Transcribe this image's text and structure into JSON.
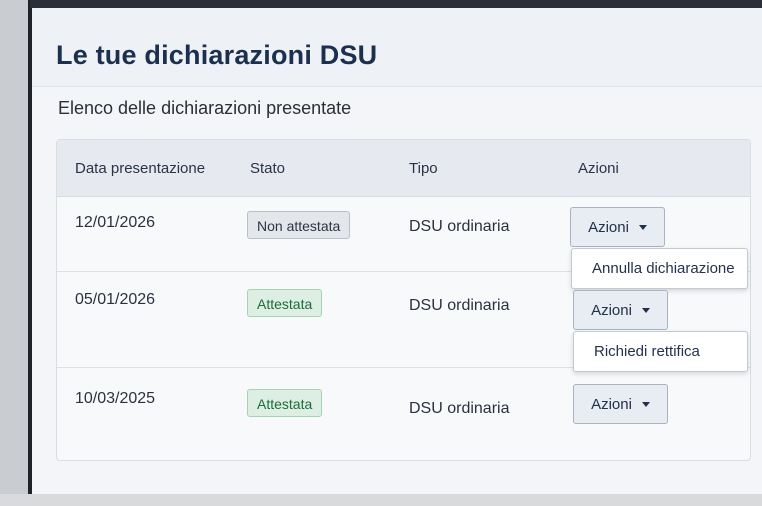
{
  "page": {
    "title": "Le tue dichiarazioni DSU",
    "subtitle": "Elenco delle dichiarazioni presentate"
  },
  "table": {
    "headers": [
      "Data presentazione",
      "Stato",
      "Tipo",
      "Azioni"
    ],
    "rows": [
      {
        "date": "12/01/2026",
        "status": "Non attestata",
        "status_kind": "neutral",
        "type": "DSU ordinaria",
        "action_label": "Azioni"
      },
      {
        "date": "05/01/2026",
        "status": "Attestata",
        "status_kind": "success",
        "type": "DSU ordinaria",
        "action_label": "Azioni"
      },
      {
        "date": "10/03/2025",
        "status": "Attestata",
        "status_kind": "success",
        "type": "DSU ordinaria",
        "action_label": "Azioni"
      }
    ]
  },
  "menus": {
    "row1": [
      "Annulla dichiarazione"
    ],
    "row2": [
      "Richiedi rettifica"
    ]
  },
  "colors": {
    "title": "#1d2f4f",
    "badge_neutral_bg": "#e3e6eb",
    "badge_success_bg": "#dcefe2",
    "badge_success_text": "#1f6b3a"
  },
  "icons": {
    "dropdown": "caret-down-icon"
  }
}
